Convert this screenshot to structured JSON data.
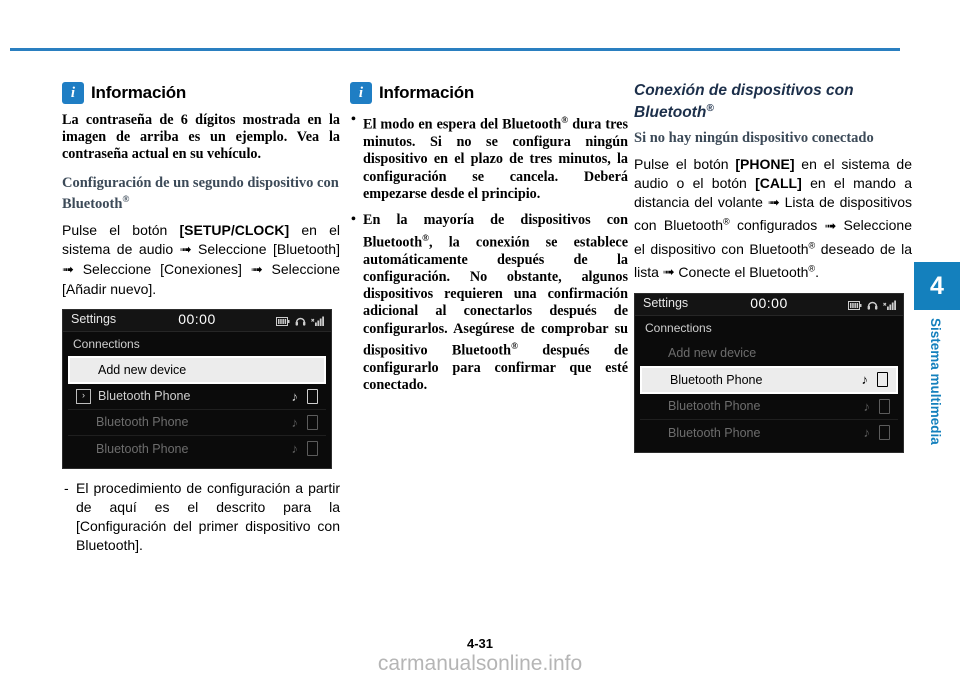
{
  "page": {
    "number": "4-31",
    "watermark": "carmanualsonline.info",
    "accent_color": "#1480bd",
    "rule_color": "#2a7fc0"
  },
  "side_tab": {
    "chapter_number": "4",
    "chapter_label": "Sistema multimedia"
  },
  "column1": {
    "info_box": {
      "icon": "info-icon",
      "title": "Información",
      "body": "La contraseña de 6 dígitos mostrada en la imagen de arriba es un ejemplo. Vea la contraseña actual en su vehículo."
    },
    "subheading": "Configuración de un segundo dispositivo con Bluetooth®",
    "paragraph": "Pulse el botón [SETUP/CLOCK] en el sistema de audio ➟ Seleccione [Bluetooth] ➟ Seleccione [Conexiones] ➟ Seleccione [Añadir nuevo].",
    "paragraph_parts": {
      "p1": "Pulse el botón ",
      "b1": "[SETUP/CLOCK]",
      "p2": " en el sistema de audio ",
      "a1": "➟",
      "p3": " Seleccione [Bluetooth] ",
      "a2": "➟",
      "p4": " Seleccione [Conexiones] ",
      "a3": "➟",
      "p5": " Seleccione [Añadir nuevo]."
    },
    "dash_note": "El procedimiento de configuración a partir de aquí es el descrito para la [Configuración del primer dispositivo con Bluetooth]."
  },
  "column2": {
    "info_box": {
      "icon": "info-icon",
      "title": "Información",
      "bullets": [
        "El modo en espera del Bluetooth® dura tres minutos. Si no se configura ningún dispositivo en el plazo de tres minutos, la configuración se cancela. Deberá empezarse desde el principio.",
        "En la mayoría de dispositivos con Bluetooth®, la conexión se establece automáticamente después de la configuración. No obstante, algunos dispositivos requieren una confirmación adicional al conectarlos después de configurarlos. Asegúrese de comprobar su dispositivo Bluetooth® después de configurarlo para confirmar que esté conectado."
      ]
    }
  },
  "column3": {
    "section_heading": "Conexión de dispositivos con Bluetooth®",
    "subheading": "Si no hay ningún dispositivo conectado",
    "paragraph_parts": {
      "p1": "Pulse el botón ",
      "b1": "[PHONE]",
      "p2": " en el sistema de audio o el botón ",
      "b2": "[CALL]",
      "p3": " en el mando a distancia del volante ",
      "a1": "➟",
      "p4": " Lista de dispositivos con Bluetooth® configurados ",
      "a2": "➟",
      "p5": " Seleccione el dispositivo con Bluetooth® deseado de la lista ",
      "a3": "➟",
      "p6": " Conecte el Bluetooth®."
    }
  },
  "device_screen_1": {
    "title": "Settings",
    "clock": "00:00",
    "breadcrumb": "Connections",
    "rows": [
      {
        "label": "Add new device",
        "state": "selected",
        "lead": "",
        "right": []
      },
      {
        "label": "Bluetooth Phone",
        "state": "active",
        "lead": "›",
        "right": [
          "music-note-icon",
          "phone-icon"
        ]
      },
      {
        "label": "Bluetooth Phone",
        "state": "dim",
        "lead": "",
        "right": [
          "music-note-icon",
          "phone-icon"
        ]
      },
      {
        "label": "Bluetooth Phone",
        "state": "dim",
        "lead": "",
        "right": [
          "music-note-icon",
          "phone-icon"
        ]
      }
    ],
    "status_icons": [
      "battery-icon",
      "headset-icon",
      "signal-icon"
    ]
  },
  "device_screen_2": {
    "title": "Settings",
    "clock": "00:00",
    "breadcrumb": "Connections",
    "rows": [
      {
        "label": "Add new device",
        "state": "dim",
        "lead": "",
        "right": []
      },
      {
        "label": "Bluetooth Phone",
        "state": "selected",
        "lead": "",
        "right": [
          "music-note-icon",
          "phone-icon"
        ]
      },
      {
        "label": "Bluetooth Phone",
        "state": "dim",
        "lead": "",
        "right": [
          "music-note-icon",
          "phone-icon"
        ]
      },
      {
        "label": "Bluetooth Phone",
        "state": "dim",
        "lead": "",
        "right": [
          "music-note-icon",
          "phone-icon"
        ]
      }
    ],
    "status_icons": [
      "battery-icon",
      "headset-icon",
      "signal-icon"
    ]
  }
}
